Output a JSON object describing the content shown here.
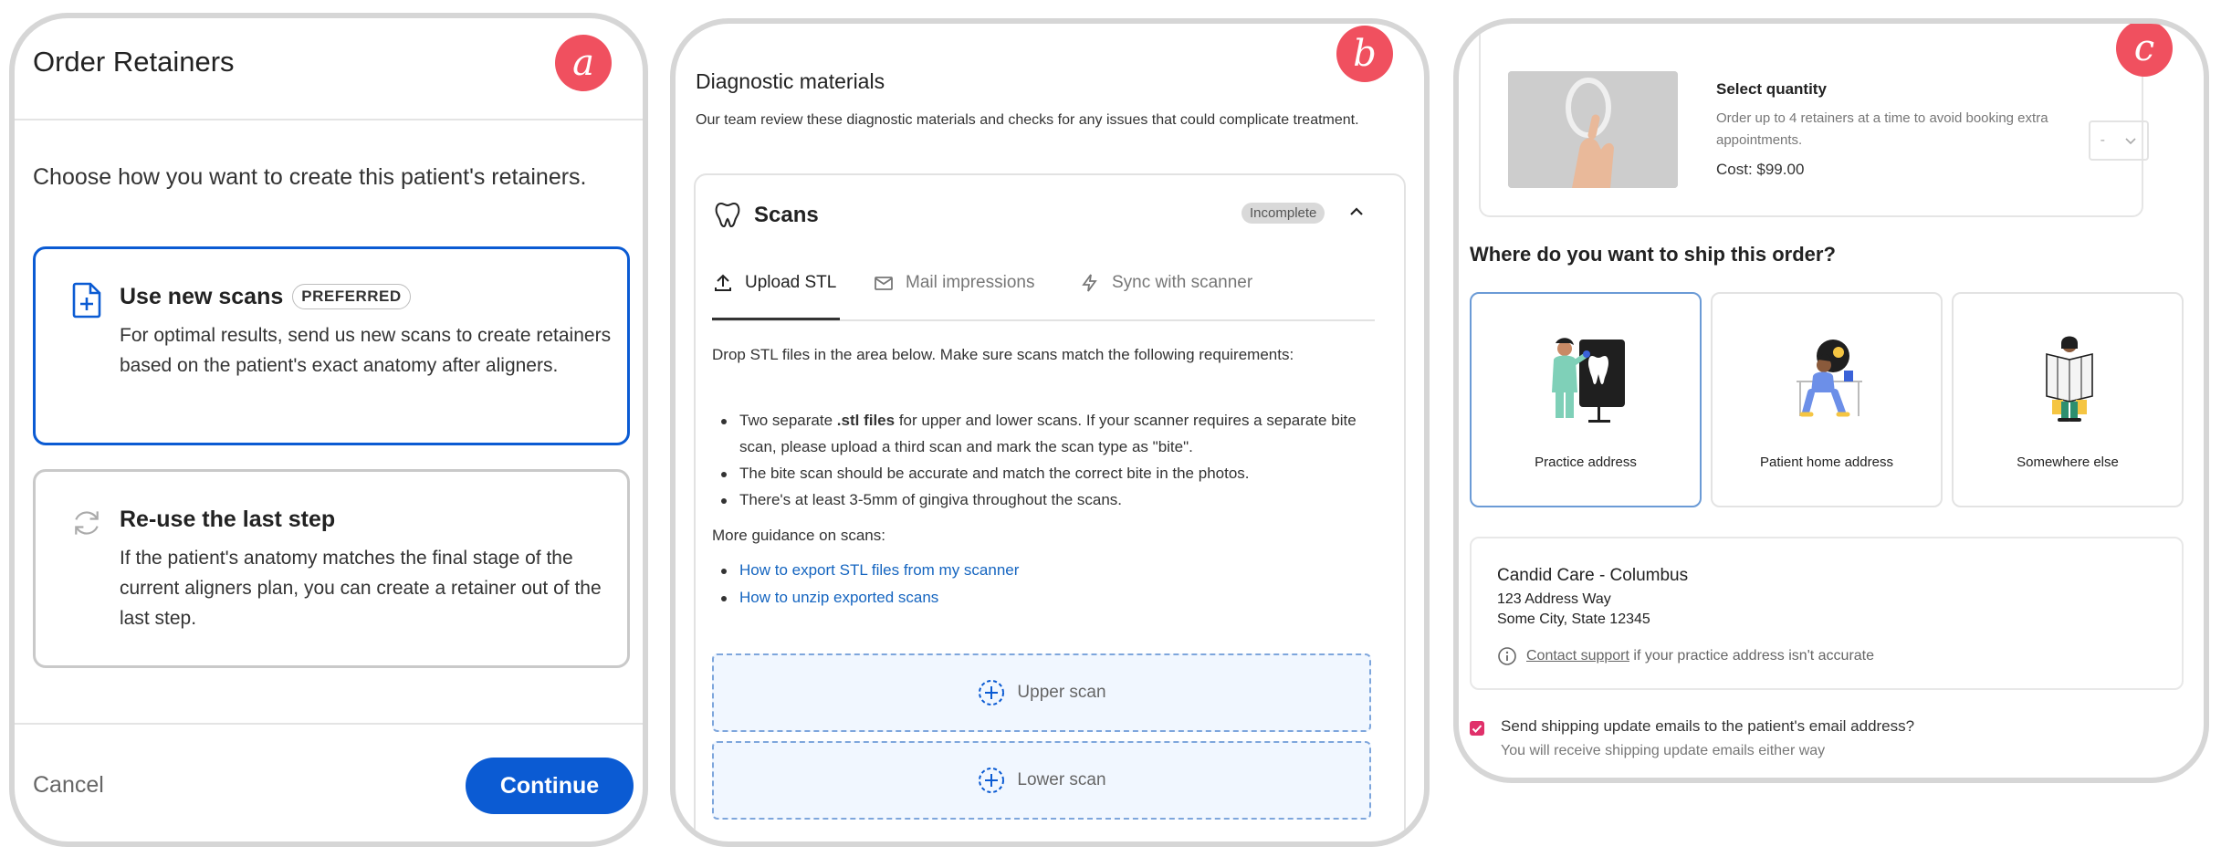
{
  "panel_a": {
    "badge": "a",
    "title": "Order Retainers",
    "intro": "Choose how you want to create this patient's retainers.",
    "option_new": {
      "title": "Use new scans",
      "badge": "PREFERRED",
      "desc": "For optimal results, send us new scans to create retainers based on the patient's exact anatomy after aligners."
    },
    "option_reuse": {
      "title": "Re-use the last step",
      "desc": "If the patient's anatomy matches the final stage of the current aligners plan, you can create a retainer out of the last step."
    },
    "cancel_label": "Cancel",
    "continue_label": "Continue",
    "accent": "#0b5bd3"
  },
  "panel_b": {
    "badge": "b",
    "title": "Diagnostic materials",
    "desc": "Our team review these diagnostic materials and checks for any issues that could complicate treatment.",
    "scans": {
      "title": "Scans",
      "status": "Incomplete",
      "tabs": [
        "Upload STL",
        "Mail impressions",
        "Sync with scanner"
      ],
      "drop_desc": "Drop STL files in the area below. Make sure scans match the following requirements:",
      "requirements": [
        {
          "pre": "Two separate ",
          "bold": ".stl files",
          "post": " for upper and lower scans. If your scanner requires a separate bite scan, please upload a third scan and mark the scan type as \"bite\"."
        },
        {
          "pre": "The bite scan should be accurate and match the correct bite in the photos.",
          "bold": "",
          "post": ""
        },
        {
          "pre": "There's at least 3-5mm of gingiva throughout the scans.",
          "bold": "",
          "post": ""
        }
      ],
      "guidance_title": "More guidance on scans:",
      "links": [
        "How to export STL files from my scanner",
        "How to unzip exported scans"
      ],
      "upper_label": "Upper scan",
      "lower_label": "Lower scan"
    }
  },
  "panel_c": {
    "badge": "c",
    "quantity": {
      "title": "Select quantity",
      "desc": "Order up to 4 retainers at a time to avoid booking extra appointments.",
      "cost": "Cost: $99.00",
      "select_value": "-"
    },
    "ship_question": "Where do you want to ship this order?",
    "ship_options": [
      "Practice address",
      "Patient home address",
      "Somewhere else"
    ],
    "address": {
      "name": "Candid Care - Columbus",
      "line1": "123 Address Way",
      "line2": "Some City, State 12345",
      "contact_link": "Contact support",
      "note_suffix": " if your practice address isn't accurate"
    },
    "email_check": {
      "checked": true,
      "label": "Send shipping update emails to the patient's email address?",
      "sub": "You will receive shipping update emails either way"
    }
  }
}
